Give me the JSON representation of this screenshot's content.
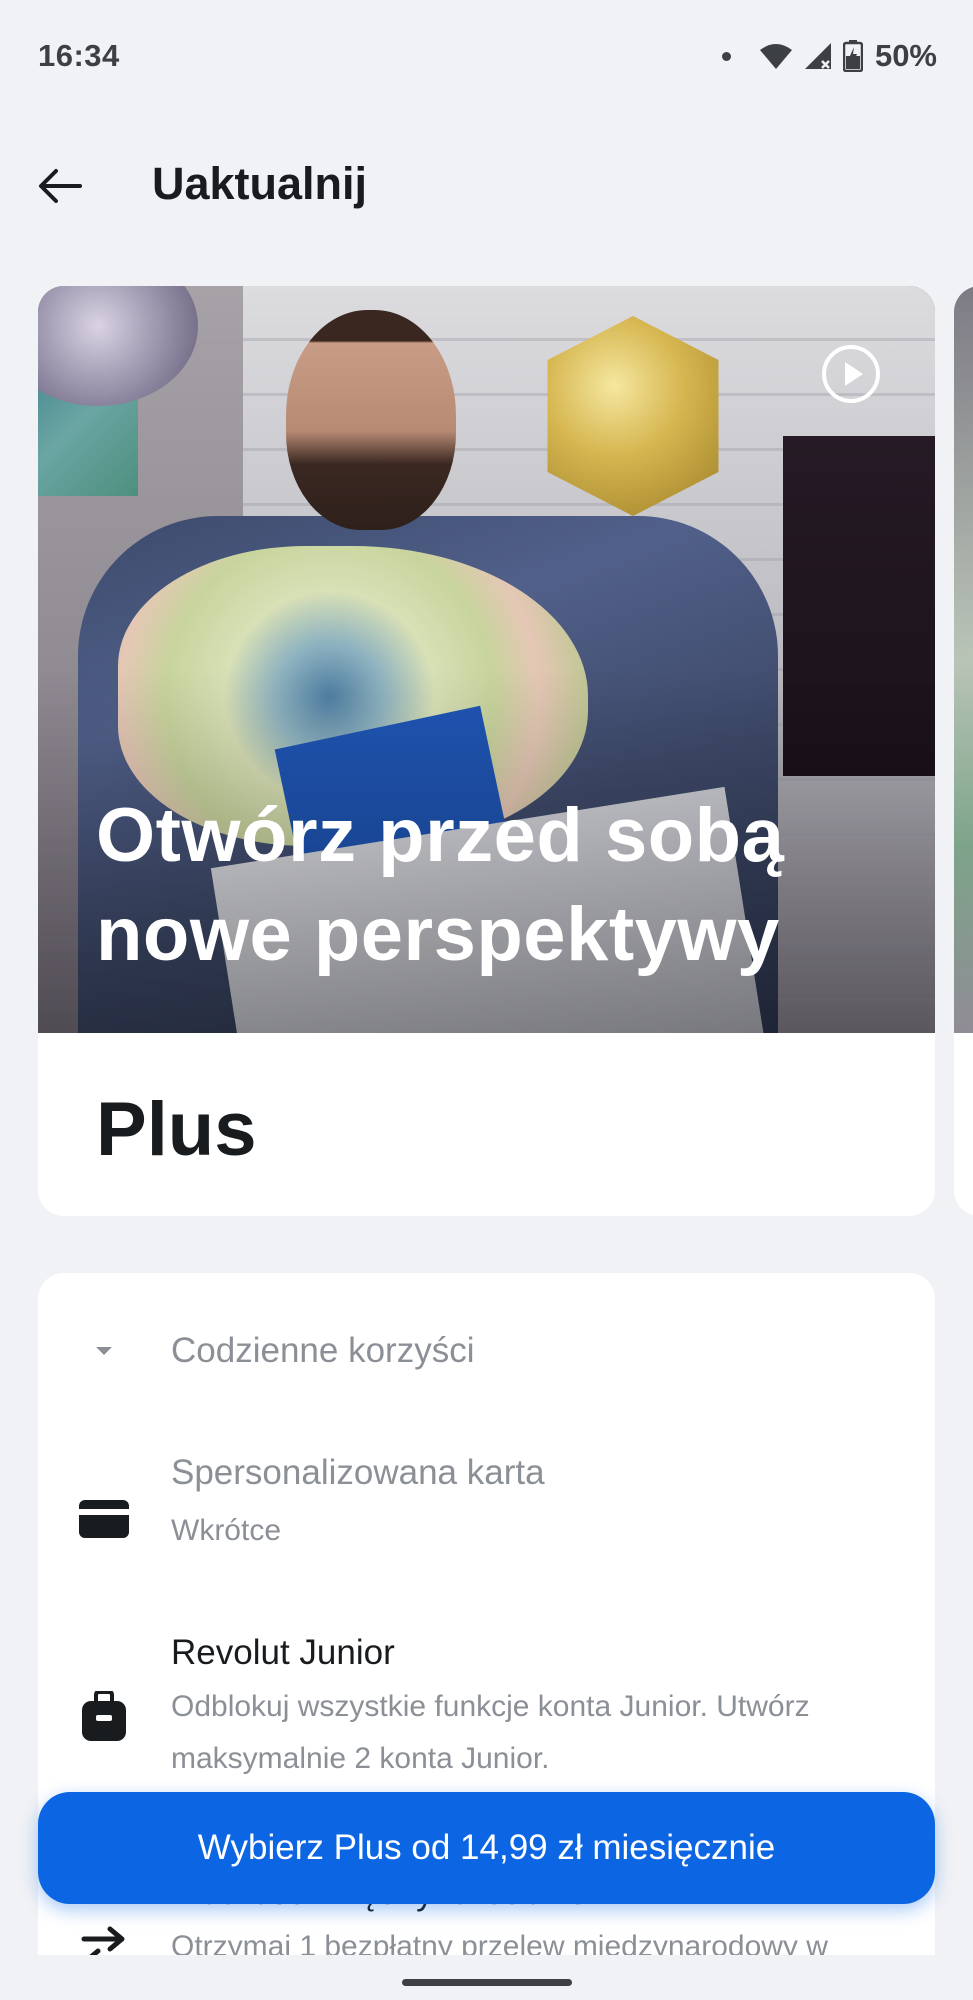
{
  "status_bar": {
    "time": "16:34",
    "battery": "50%"
  },
  "header": {
    "title": "Uaktualnij"
  },
  "plan": {
    "hero_title": "Otwórz przed sobą nowe perspektywy",
    "name": "Plus"
  },
  "benefits": {
    "section_title": "Codzienne korzyści",
    "items": [
      {
        "title": "Spersonalizowana karta",
        "subtitle": "Wkrótce",
        "icon": "card-icon"
      },
      {
        "title": "Revolut Junior",
        "subtitle": "Odblokuj wszystkie funkcje konta Junior. Utwórz maksymalnie 2 konta Junior.",
        "icon": "backpack-icon"
      },
      {
        "title": "Płatności międzynarodowe",
        "subtitle": "Otrzymaj 1 bezpłatny przelew międzynarodowy w",
        "icon": "transfer-arrows-icon"
      }
    ]
  },
  "cta": {
    "label": "Wybierz Plus od 14,99 zł miesięcznie"
  },
  "colors": {
    "accent": "#0c66e4",
    "background": "#f1f2f5",
    "muted_text": "#8b8f96"
  }
}
